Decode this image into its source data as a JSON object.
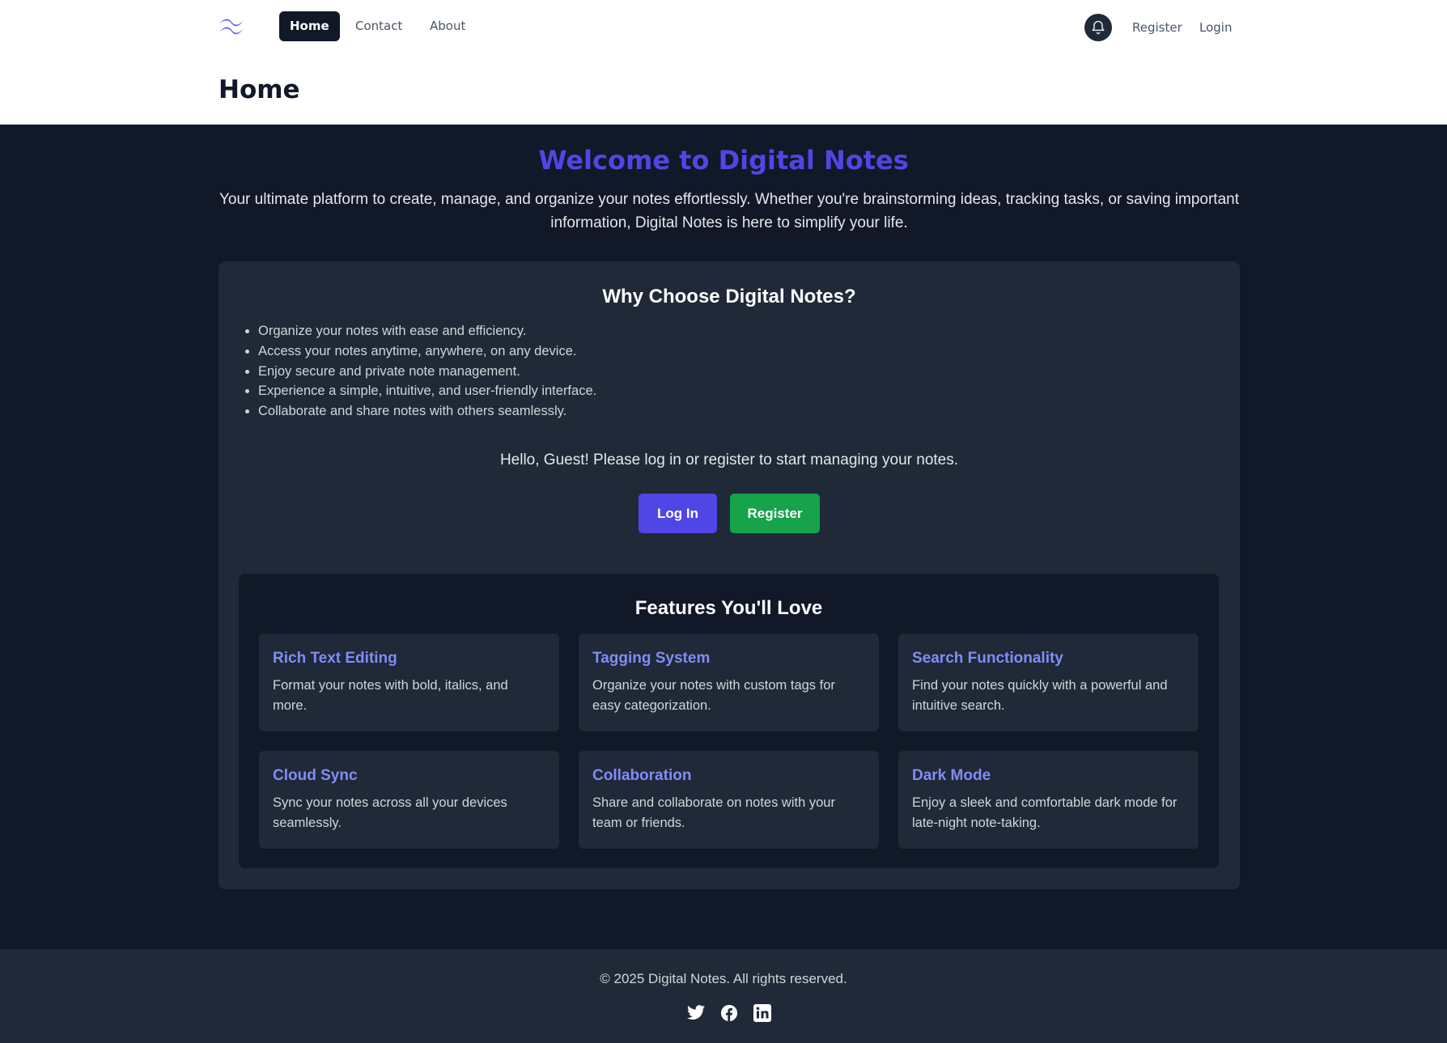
{
  "nav": {
    "links": [
      {
        "label": "Home",
        "active": true
      },
      {
        "label": "Contact",
        "active": false
      },
      {
        "label": "About",
        "active": false
      }
    ],
    "register": "Register",
    "login": "Login"
  },
  "page": {
    "title": "Home"
  },
  "hero": {
    "title": "Welcome to Digital Notes",
    "text": "Your ultimate platform to create, manage, and organize your notes effortlessly. Whether you're brainstorming ideas, tracking tasks, or saving important information, Digital Notes is here to simplify your life."
  },
  "why": {
    "title": "Why Choose Digital Notes?",
    "items": [
      "Organize your notes with ease and efficiency.",
      "Access your notes anytime, anywhere, on any device.",
      "Enjoy secure and private note management.",
      "Experience a simple, intuitive, and user-friendly interface.",
      "Collaborate and share notes with others seamlessly."
    ]
  },
  "guest": {
    "text": "Hello, Guest! Please log in or register to start managing your notes.",
    "login_label": "Log In",
    "register_label": "Register"
  },
  "features": {
    "title": "Features You'll Love",
    "items": [
      {
        "title": "Rich Text Editing",
        "desc": "Format your notes with bold, italics, and more."
      },
      {
        "title": "Tagging System",
        "desc": "Organize your notes with custom tags for easy categorization."
      },
      {
        "title": "Search Functionality",
        "desc": "Find your notes quickly with a powerful and intuitive search."
      },
      {
        "title": "Cloud Sync",
        "desc": "Sync your notes across all your devices seamlessly."
      },
      {
        "title": "Collaboration",
        "desc": "Share and collaborate on notes with your team or friends."
      },
      {
        "title": "Dark Mode",
        "desc": "Enjoy a sleek and comfortable dark mode for late-night note-taking."
      }
    ]
  },
  "footer": {
    "copyright": "© 2025 Digital Notes. All rights reserved.",
    "icons": [
      "twitter-icon",
      "facebook-icon",
      "linkedin-icon"
    ]
  },
  "colors": {
    "accent": "#4f46e5",
    "feature_title": "#818cf8",
    "success": "#16a34a",
    "background": "#111827",
    "card": "#1f2937"
  }
}
